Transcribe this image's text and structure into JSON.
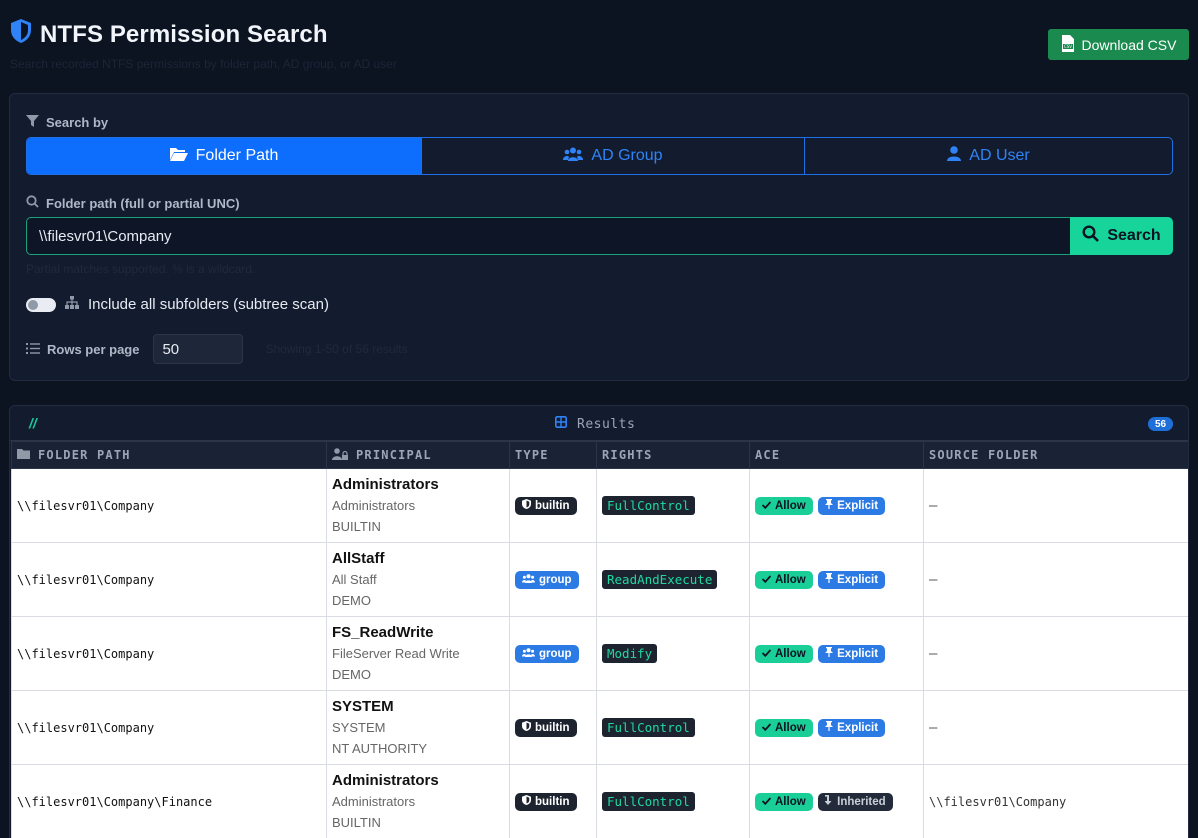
{
  "header": {
    "title": "NTFS Permission Search",
    "subtitle": "Search recorded NTFS permissions by folder path, AD group, or AD user",
    "download_label": "Download CSV"
  },
  "search": {
    "search_by_label": "Search by",
    "tabs": [
      {
        "label": "Folder Path",
        "icon": "folder-open-icon",
        "active": true
      },
      {
        "label": "AD Group",
        "icon": "users-icon",
        "active": false
      },
      {
        "label": "AD User",
        "icon": "user-icon",
        "active": false
      }
    ],
    "field_label": "Folder path (full or partial UNC)",
    "value": "\\\\filesvr01\\Company",
    "button_label": "Search",
    "hint": "Partial matches supported. % is a wildcard.",
    "subfolders_label": "Include all subfolders (subtree scan)",
    "subfolders_enabled": false,
    "rows_label": "Rows per page",
    "rows_value": "50",
    "showing": "Showing 1-50 of 56 results"
  },
  "results": {
    "slash": "//",
    "title": "Results",
    "count": "56",
    "columns": [
      "FOLDER PATH",
      "PRINCIPAL",
      "TYPE",
      "RIGHTS",
      "ACE",
      "SOURCE FOLDER"
    ],
    "rows": [
      {
        "path": "\\\\filesvr01\\Company",
        "name": "Administrators",
        "display": "Administrators",
        "domain": "BUILTIN",
        "type": "builtin",
        "rights": "FullControl",
        "ace": "Allow",
        "origin": "Explicit",
        "source": "—"
      },
      {
        "path": "\\\\filesvr01\\Company",
        "name": "AllStaff",
        "display": "All Staff",
        "domain": "DEMO",
        "type": "group",
        "rights": "ReadAndExecute",
        "ace": "Allow",
        "origin": "Explicit",
        "source": "—"
      },
      {
        "path": "\\\\filesvr01\\Company",
        "name": "FS_ReadWrite",
        "display": "FileServer Read Write",
        "domain": "DEMO",
        "type": "group",
        "rights": "Modify",
        "ace": "Allow",
        "origin": "Explicit",
        "source": "—"
      },
      {
        "path": "\\\\filesvr01\\Company",
        "name": "SYSTEM",
        "display": "SYSTEM",
        "domain": "NT AUTHORITY",
        "type": "builtin",
        "rights": "FullControl",
        "ace": "Allow",
        "origin": "Explicit",
        "source": "—"
      },
      {
        "path": "\\\\filesvr01\\Company\\Finance",
        "name": "Administrators",
        "display": "Administrators",
        "domain": "BUILTIN",
        "type": "builtin",
        "rights": "FullControl",
        "ace": "Allow",
        "origin": "Inherited",
        "source": "\\\\filesvr01\\Company"
      }
    ]
  },
  "colors": {
    "background": "#0c1321",
    "panel": "#131c2e",
    "primary": "#0d6efd",
    "accent": "#17d49b",
    "csv_button": "#1a8a4f"
  }
}
